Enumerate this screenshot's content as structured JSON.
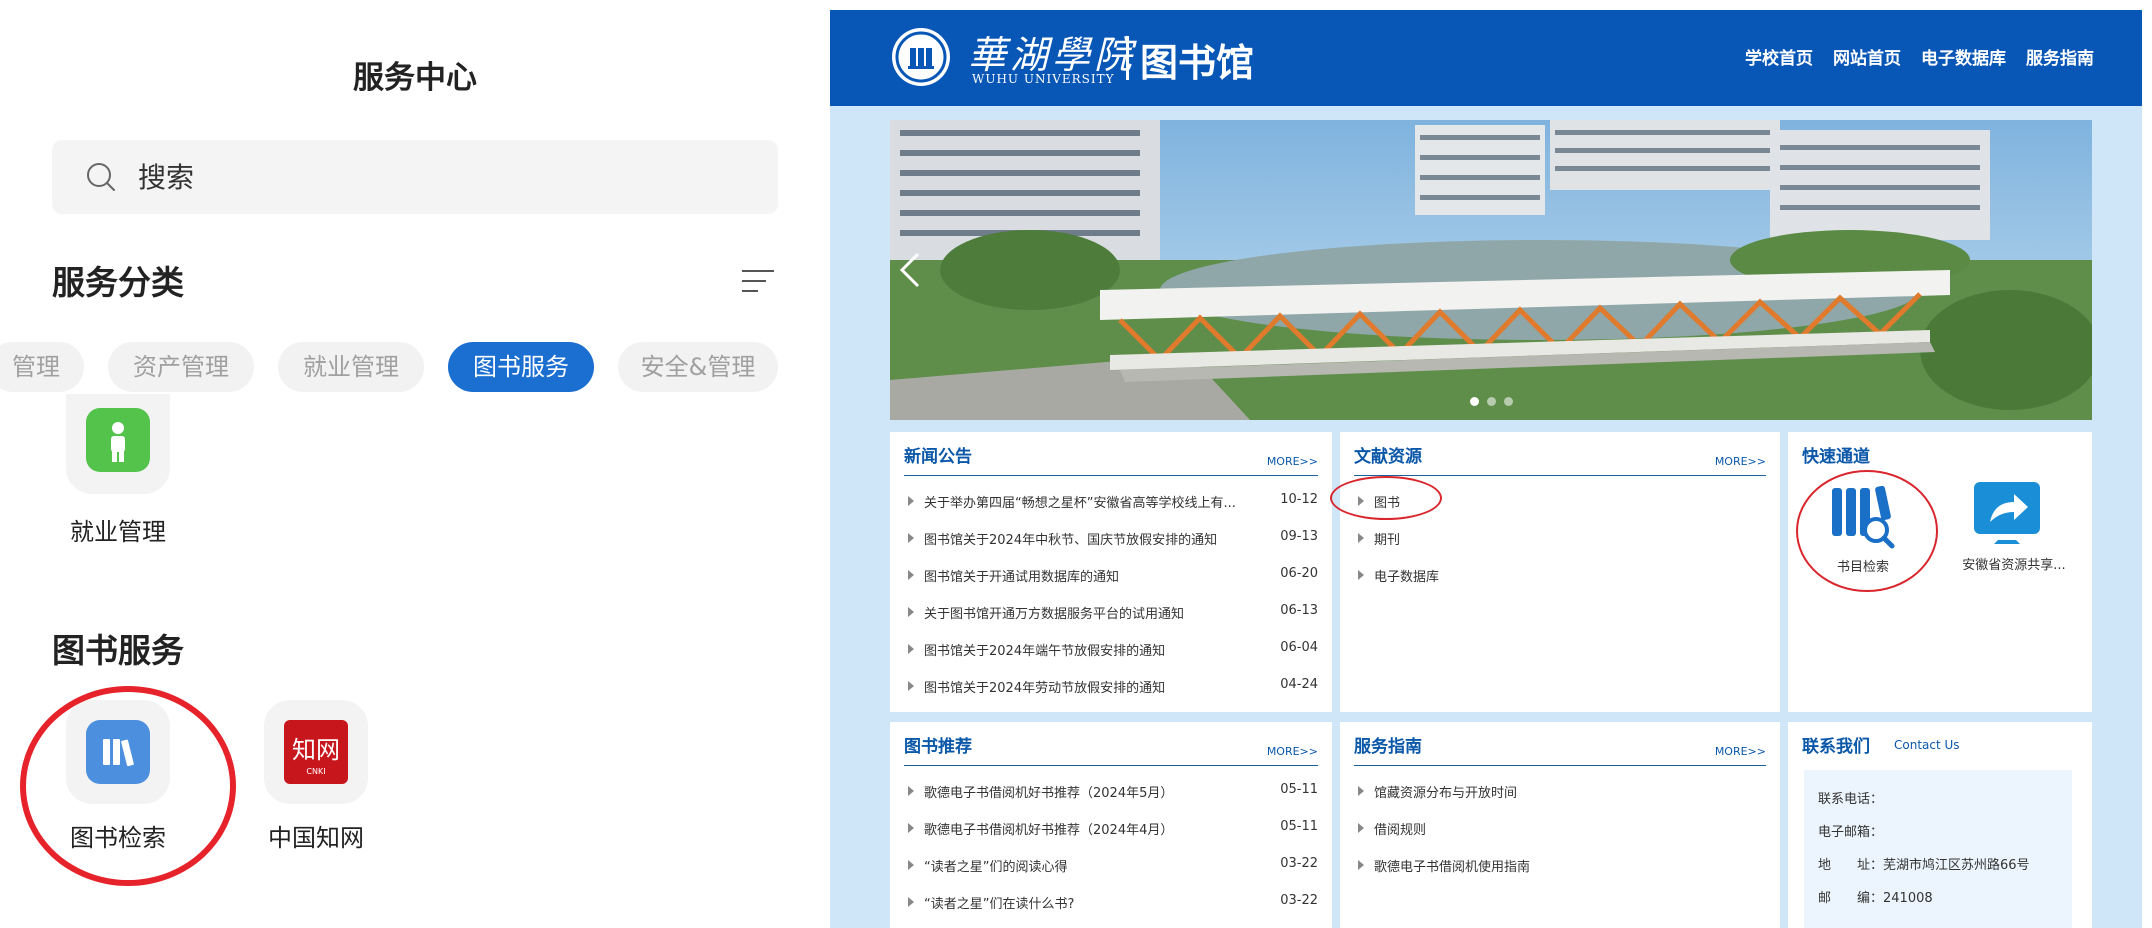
{
  "mobile": {
    "title": "服务中心",
    "search": {
      "placeholder": "搜索"
    },
    "category_heading": "服务分类",
    "chips": [
      "管理",
      "资产管理",
      "就业管理",
      "图书服务",
      "安全&管理"
    ],
    "active_chip": "图书服务",
    "employment_app": {
      "label": "就业管理",
      "icon": "person-icon"
    },
    "library_section": {
      "heading": "图书服务",
      "apps": [
        {
          "label": "图书检索",
          "icon": "books-icon"
        },
        {
          "label": "中国知网",
          "icon": "cnki-logo",
          "logo_text": "知网",
          "logo_sub": "CNKI"
        }
      ]
    },
    "colors": {
      "accent": "#1a6fd1",
      "highlight_ring": "#e6232a",
      "employment_icon": "#54c34c",
      "cnki": "#c8161d"
    }
  },
  "library_site": {
    "logo": {
      "cn": "華湖學院",
      "en": "WUHU UNIVERSITY",
      "lib": "图书馆"
    },
    "nav": [
      "学校首页",
      "网站首页",
      "电子数据库",
      "服务指南"
    ],
    "news": {
      "title": "新闻公告",
      "more": "MORE>>",
      "items": [
        {
          "text": "关于举办第四届“畅想之星杯”安徽省高等学校线上有...",
          "date": "10-12"
        },
        {
          "text": "图书馆关于2024年中秋节、国庆节放假安排的通知",
          "date": "09-13"
        },
        {
          "text": "图书馆关于开通试用数据库的通知",
          "date": "06-20"
        },
        {
          "text": "关于图书馆开通万方数据服务平台的试用通知",
          "date": "06-13"
        },
        {
          "text": "图书馆关于2024年端午节放假安排的通知",
          "date": "06-04"
        },
        {
          "text": "图书馆关于2024年劳动节放假安排的通知",
          "date": "04-24"
        }
      ]
    },
    "resources": {
      "title": "文献资源",
      "more": "MORE>>",
      "items": [
        "图书",
        "期刊",
        "电子数据库"
      ]
    },
    "quick": {
      "title": "快速通道",
      "items": [
        {
          "label": "书目检索",
          "icon": "catalog-search-icon"
        },
        {
          "label": "安徽省资源共享...",
          "icon": "share-arrow-icon"
        }
      ]
    },
    "recommend": {
      "title": "图书推荐",
      "more": "MORE>>",
      "items": [
        {
          "text": "歌德电子书借阅机好书推荐（2024年5月）",
          "date": "05-11"
        },
        {
          "text": "歌德电子书借阅机好书推荐（2024年4月）",
          "date": "05-11"
        },
        {
          "text": "“读者之星”们的阅读心得",
          "date": "03-22"
        },
        {
          "text": "“读者之星”们在读什么书?",
          "date": "03-22"
        }
      ]
    },
    "guide": {
      "title": "服务指南",
      "more": "MORE>>",
      "items": [
        "馆藏资源分布与开放时间",
        "借阅规则",
        "歌德电子书借阅机使用指南"
      ]
    },
    "contact": {
      "title": "联系我们",
      "subtitle": "Contact Us",
      "rows": [
        "联系电话：",
        "电子邮箱：",
        "地　　址：芜湖市鸠江区苏州路66号",
        "邮　　编：241008"
      ]
    },
    "colors": {
      "header": "#0857b6",
      "page_bg": "#cfe6f8",
      "link": "#0b58a9",
      "ring": "#d9262c"
    }
  }
}
